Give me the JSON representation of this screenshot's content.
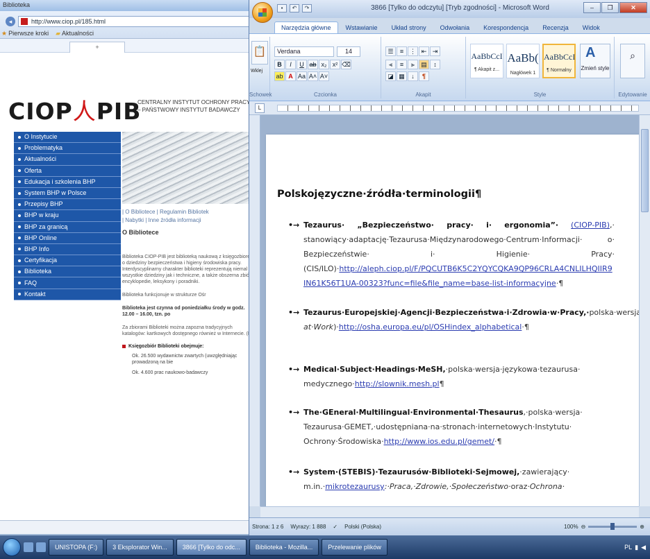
{
  "browser": {
    "window_title": "Biblioteka",
    "url": "http://www.ciop.pl/185.html",
    "links": [
      "Pierwsze kroki",
      "Aktualności"
    ],
    "header": {
      "logo_left": "CIOP",
      "logo_mark": "⼈",
      "logo_right": "PIB",
      "org_line1": "CENTRALNY INSTYTUT OCHRONY PRACY",
      "org_line2": "– PAŃSTWOWY INSTYTUT BADAWCZY"
    },
    "menu": [
      {
        "label": "O Instytucie"
      },
      {
        "label": "Problematyka"
      },
      {
        "label": "Aktualności"
      },
      {
        "label": "Oferta"
      },
      {
        "label": "Edukacja i szkolenia BHP"
      },
      {
        "label": "System BHP w Polsce"
      },
      {
        "label": "Przepisy BHP"
      },
      {
        "label": "BHP w kraju"
      },
      {
        "label": "BHP za granicą"
      },
      {
        "label": "BHP Online"
      },
      {
        "label": "BHP Info"
      },
      {
        "label": "Certyfikacja"
      },
      {
        "label": "Biblioteka"
      },
      {
        "label": "FAQ"
      },
      {
        "label": "Kontakt"
      }
    ],
    "content": {
      "links_line1": "| O Bibliotece | Regulamin Bibliotek",
      "links_line2": "| Nabytki | Inne źródła informacji",
      "title": "O Bibliotece",
      "p1": "Biblioteka CIOP-PIB jest biblioteką naukową z księgozbiorem o dziedziny bezpieczeństwa i higieny środowiska pracy. Interdyscyplinarny charakter biblioteki reprezentują niemal wszystkie dziedziny jak i techniczne, a także obszerna zbiór encyklopedie, leksykony i poradniki.",
      "p2": "Biblioteka funkcjonuje w strukturze Ośr",
      "p3": "Biblioteka jest czynna od poniedziałku środy w godz. 12.00 – 16.00, tzn. po",
      "p4": "Za zbiorami Biblioteki można zapozna tradycyjnych katalogów: kartkowych dostępnego również w Internecie. (Inf",
      "bullet_heading": "Księgozbiór Biblioteki obejmuje:",
      "sub1": "Ok. 26.500 wydawnictw zwartych (uwzględniając prowadzoną na bie",
      "sub2": "Ok. 4.600 prac naukowo-badawczy"
    }
  },
  "word": {
    "title": "3866 [Tylko do odczytu] [Tryb zgodności] - Microsoft Word",
    "ribbon_tabs": [
      "Narzędzia główne",
      "Wstawianie",
      "Układ strony",
      "Odwołania",
      "Korespondencja",
      "Recenzja",
      "Widok"
    ],
    "font": "Verdana",
    "font_size": "14",
    "groups": {
      "clipboard": "Schowek",
      "font": "Czcionka",
      "paragraph": "Akapit",
      "styles": "Style",
      "editing": "Edytowanie"
    },
    "paste_label": "Wklej",
    "change_styles": "Zmień style",
    "styles": [
      {
        "sample": "AaBbCcI",
        "name": "¶ Akapit z..."
      },
      {
        "sample": "AaBb(",
        "name": "Nagłówek 1"
      },
      {
        "sample": "AaBbCcI",
        "name": "¶ Normalny"
      }
    ],
    "document": {
      "heading": "Polskojęzyczne·źródła·terminologii¶",
      "entries": [
        {
          "bold": "Tezaurus· „Bezpieczeństwo· pracy· i· ergonomia”·",
          "link1": "(CIOP-PIB)",
          "text1": ",· stanowiący·adaptację·Tezaurusa·Międzynarodowego·Centrum·Informacji· o· Bezpieczeństwie· i· Higienie· Pracy· (CIS/ILO)·",
          "link2": "http://aleph.ciop.pl/F/PQCUTB6K5C2YQYCQKA9QP96CRLA4CNLILHQIIR9 IN61K56T1UA-00323?func=file&file_name=base-list-informacyjne",
          "tail": "·¶"
        },
        {
          "bold": "Tezaurus·Europejskiej·Agencji·Bezpieczeństwa·i·Zdrowia·w·Pracy,·",
          "text1": "polska·wersja·(",
          "italic": "Thesaurus·of·the·European·Agency·of·Safety·and·Health· at·Work",
          "text2": ")·",
          "link2": "http://osha.europa.eu/pl/OSHindex_alphabetical",
          "tail": "·¶"
        },
        {
          "bold": "Medical·Subject·Headings·MeSH,",
          "text1": "·polska·wersja·językowa·tezaurusa· medycznego·",
          "link2": "http://slownik.mesh.pl",
          "tail": "¶"
        },
        {
          "bold": "The·GEneral·Multilingual·Environmental·Thesaurus",
          "text1": ",·polska·wersja· Tezaurusa·GEMET,·udostępniana·na·stronach·internetowych·Instytutu· Ochrony·Środowiska·",
          "link2": "http://www.ios.edu.pl/gemet/",
          "tail": "·¶"
        },
        {
          "bold": "System·(STEBIS)·Tezaurusów·Biblioteki·Sejmowej,",
          "text1": "·zawierający· m.in.·",
          "link1": "mikrotezaurusy",
          "italic": ":·Praca,·Zdrowie,·Społeczeństwo·",
          "text2": "oraz·",
          "italic2": "Ochrona·"
        }
      ]
    },
    "status": {
      "page": "Strona: 1 z 6",
      "words": "Wyrazy: 1 888",
      "language": "Polski (Polska)",
      "zoom": "100%"
    }
  },
  "taskbar": {
    "items": [
      "UNISTOPA (F:)",
      "3 Eksplorator Win...",
      "3866 [Tylko do odc...",
      "Biblioteka - Mozilla...",
      "Przelewanie plików"
    ],
    "tray": "PL"
  },
  "colors": {
    "menu_blue": "#1e57a8",
    "logo_red": "#d01818",
    "link_blue": "#2a3bb0",
    "accent_orange": "#f0b53a"
  }
}
